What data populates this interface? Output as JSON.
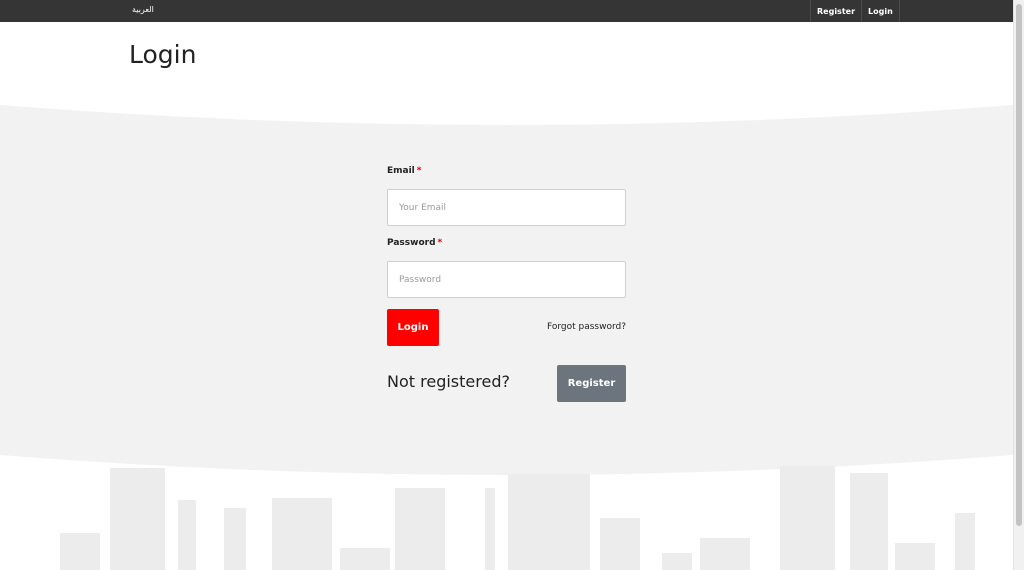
{
  "topbar": {
    "language_link": "العربية",
    "links": [
      "Register",
      "Login"
    ]
  },
  "page": {
    "title": "Login"
  },
  "form": {
    "email": {
      "label": "Email",
      "required_mark": "*",
      "placeholder": "Your Email",
      "value": ""
    },
    "password": {
      "label": "Password",
      "required_mark": "*",
      "placeholder": "Password",
      "value": ""
    },
    "login_button": "Login",
    "forgot_password": "Forgot password?",
    "not_registered": "Not registered?",
    "register_button": "Register"
  },
  "colors": {
    "topbar": "#353535",
    "accent_red": "#ff0000",
    "register_gray": "#6c757d",
    "band_gray": "#f2f2f2"
  }
}
